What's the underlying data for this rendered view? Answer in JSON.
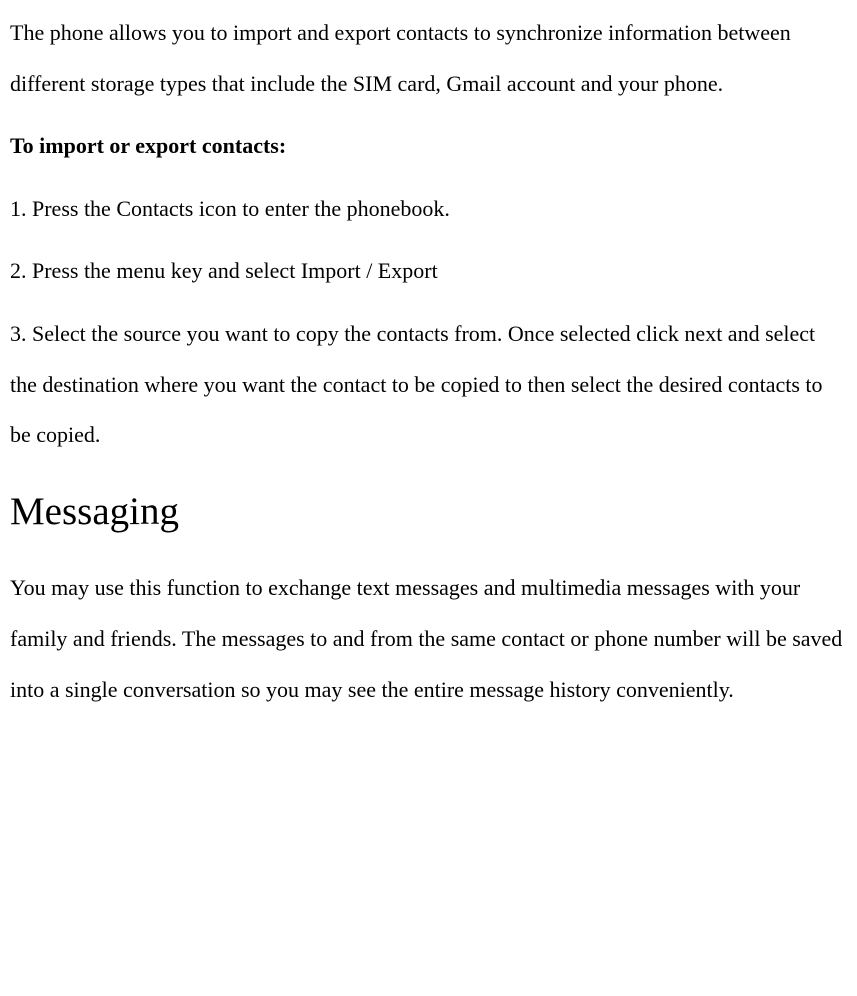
{
  "intro_paragraph": "The phone allows you to import and export contacts to synchronize information between different storage types that include the SIM card, Gmail account and your phone.",
  "subheading": "To import or export contacts:",
  "steps": {
    "step1": "1. Press the Contacts icon to enter the phonebook.",
    "step2": "2. Press the menu key and select Import / Export",
    "step3": "3. Select the source you want to copy the contacts from. Once selected click next and select the destination where you want the contact to be copied to then select the desired contacts to be copied."
  },
  "section_heading": "Messaging",
  "messaging_paragraph": "You may use this function to exchange text messages and multimedia messages with your family and friends. The messages to and from the same contact or phone number will be saved into a single conversation so you may see the entire message history conveniently."
}
